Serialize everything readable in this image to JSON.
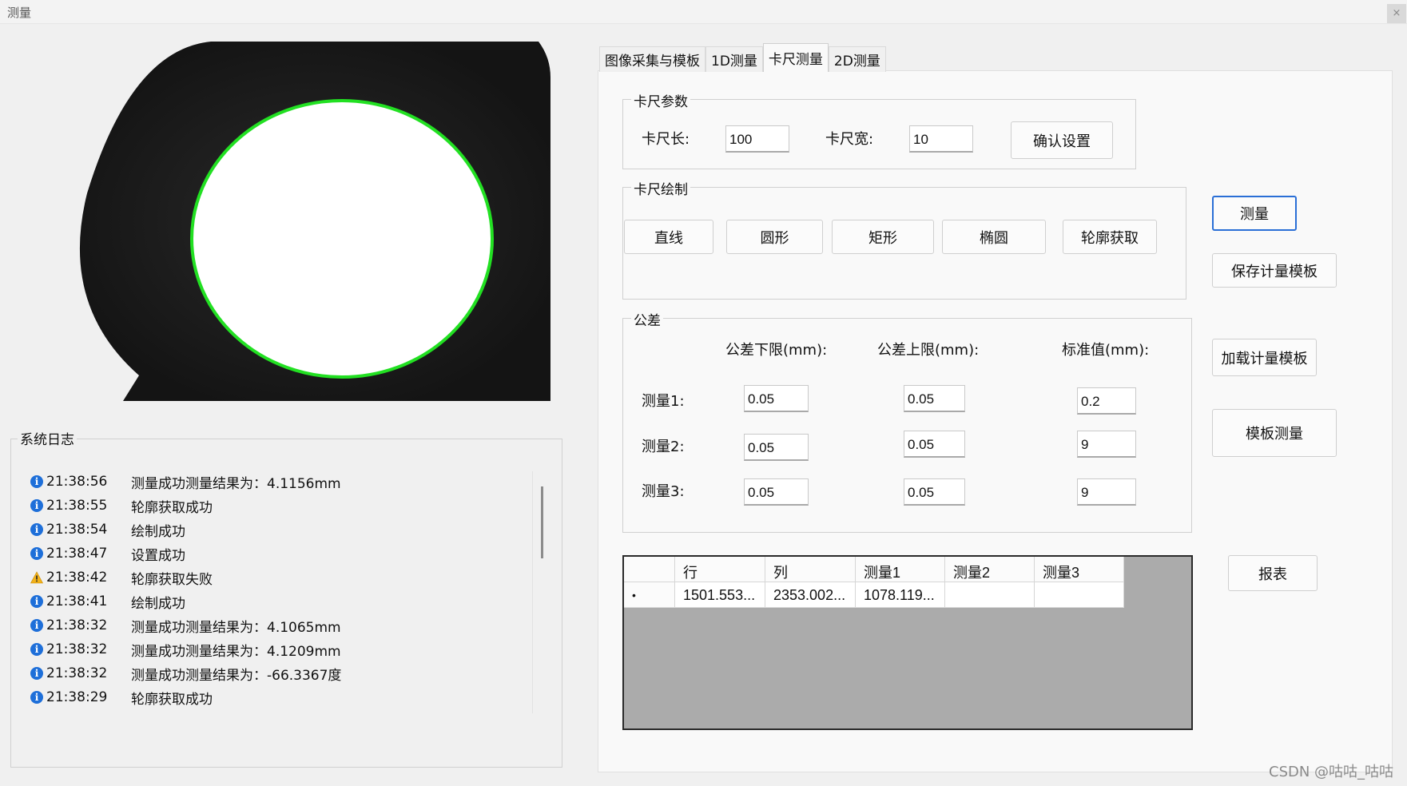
{
  "window": {
    "title": "测量",
    "close_glyph": "×"
  },
  "log": {
    "title": "系统日志",
    "entries": [
      {
        "icon": "info-icon",
        "time": "21:38:56",
        "message": "测量成功测量结果为：4.1156mm"
      },
      {
        "icon": "info-icon",
        "time": "21:38:55",
        "message": "轮廓获取成功"
      },
      {
        "icon": "info-icon",
        "time": "21:38:54",
        "message": "绘制成功"
      },
      {
        "icon": "info-icon",
        "time": "21:38:47",
        "message": "设置成功"
      },
      {
        "icon": "warning-icon",
        "time": "21:38:42",
        "message": "轮廓获取失败"
      },
      {
        "icon": "info-icon",
        "time": "21:38:41",
        "message": "绘制成功"
      },
      {
        "icon": "info-icon",
        "time": "21:38:32",
        "message": "测量成功测量结果为：4.1065mm"
      },
      {
        "icon": "info-icon",
        "time": "21:38:32",
        "message": "测量成功测量结果为：4.1209mm"
      },
      {
        "icon": "info-icon",
        "time": "21:38:32",
        "message": "测量成功测量结果为：-66.3367度"
      },
      {
        "icon": "info-icon",
        "time": "21:38:29",
        "message": "轮廓获取成功"
      }
    ]
  },
  "tabs": [
    {
      "label": "图像采集与模板",
      "active": false
    },
    {
      "label": "1D测量",
      "active": false
    },
    {
      "label": "卡尺测量",
      "active": true
    },
    {
      "label": "2D测量",
      "active": false
    }
  ],
  "caliper_params": {
    "title": "卡尺参数",
    "length_label": "卡尺长:",
    "length_value": "100",
    "width_label": "卡尺宽:",
    "width_value": "10",
    "confirm_button": "确认设置"
  },
  "caliper_draw": {
    "title": "卡尺绘制",
    "buttons": {
      "line": "直线",
      "circle": "圆形",
      "rectangle": "矩形",
      "ellipse": "椭圆",
      "contour": "轮廓获取"
    }
  },
  "tolerance": {
    "title": "公差",
    "headers": {
      "lower": "公差下限(mm):",
      "upper": "公差上限(mm):",
      "standard": "标准值(mm):"
    },
    "rows": [
      {
        "label": "测量1:",
        "lower": "0.05",
        "upper": "0.05",
        "standard": "0.2"
      },
      {
        "label": "测量2:",
        "lower": "0.05",
        "upper": "0.05",
        "standard": "9"
      },
      {
        "label": "测量3:",
        "lower": "0.05",
        "upper": "0.05",
        "standard": "9"
      }
    ]
  },
  "actions": {
    "measure": "测量",
    "save_template": "保存计量模板",
    "load_template": "加载计量模板",
    "template_measure": "模板测量",
    "report": "报表"
  },
  "results_grid": {
    "columns": [
      "行",
      "列",
      "测量1",
      "测量2",
      "测量3"
    ],
    "row_marker": "•",
    "rows": [
      [
        "1501.553...",
        "2353.002...",
        "1078.119...",
        "",
        ""
      ]
    ]
  },
  "watermark": "CSDN @咕咕_咕咕"
}
